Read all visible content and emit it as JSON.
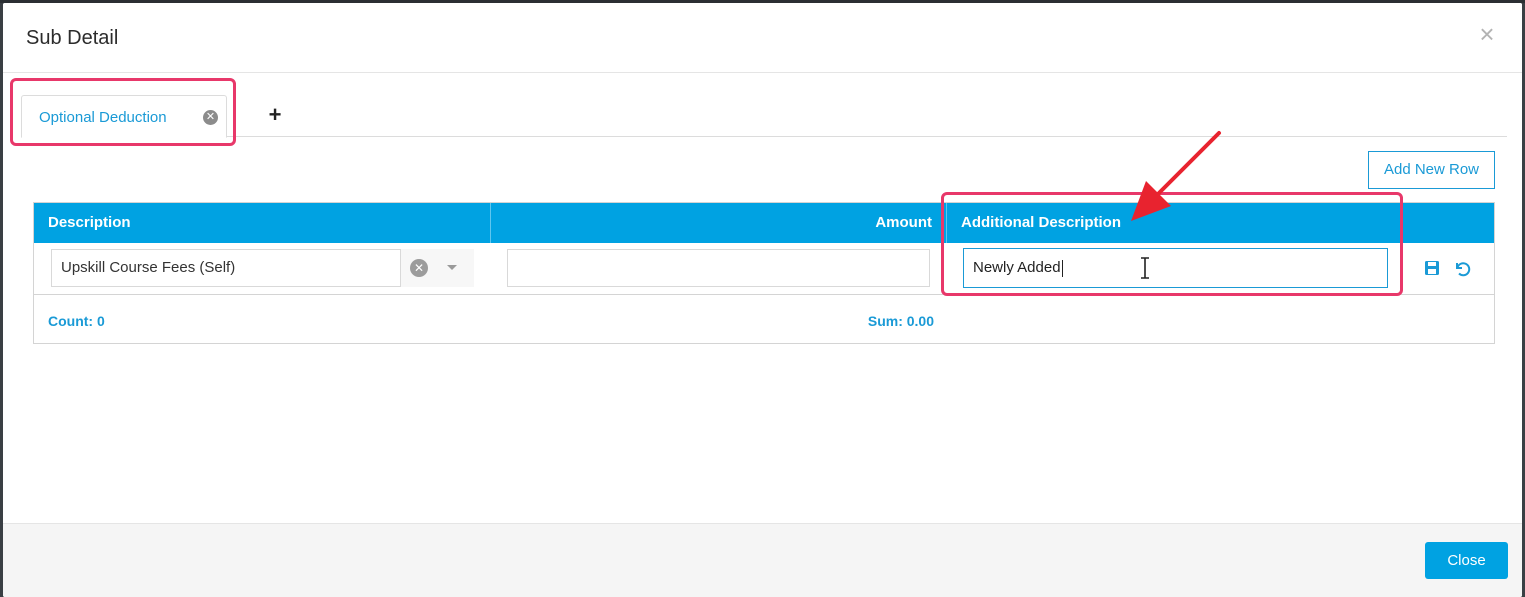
{
  "modal": {
    "title": "Sub Detail",
    "close_glyph": "×"
  },
  "tabs": [
    {
      "label": "Optional Deduction",
      "close_glyph": "✕"
    }
  ],
  "tab_add_glyph": "+",
  "toolbar": {
    "add_row_label": "Add New Row"
  },
  "grid": {
    "columns": [
      "Description",
      "Amount",
      "Additional Description"
    ],
    "row": {
      "description": "Upskill Course Fees (Self)",
      "amount": "",
      "additional_description": "Newly Added",
      "clear_glyph": "✕"
    },
    "footer": {
      "count": "Count: 0",
      "sum": "Sum: 0.00"
    }
  },
  "footer": {
    "close_label": "Close"
  },
  "colors": {
    "accent": "#00a2e2",
    "highlight": "#e8386a",
    "arrow": "#e8232f"
  },
  "icons": [
    "close-icon",
    "tab-close-icon",
    "plus-icon",
    "clear-icon",
    "chevron-down-icon",
    "save-icon",
    "undo-icon",
    "text-cursor-icon",
    "annotation-arrow"
  ]
}
